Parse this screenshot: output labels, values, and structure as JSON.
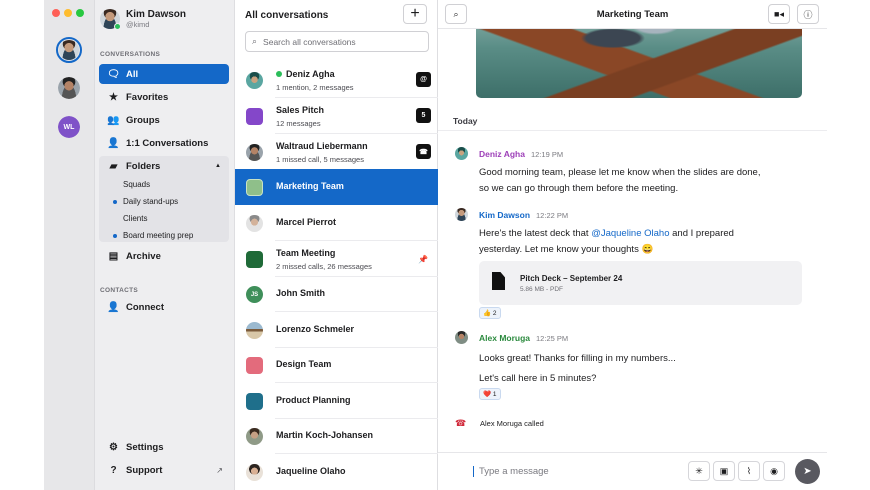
{
  "user": {
    "name": "Kim Dawson",
    "handle": "@kimd"
  },
  "rail": {
    "wl_initials": "WL"
  },
  "sidebar": {
    "conversations_header": "CONVERSATIONS",
    "items": [
      {
        "label": "All",
        "icon": "chat-bubble-icon"
      },
      {
        "label": "Favorites",
        "icon": "star-icon"
      },
      {
        "label": "Groups",
        "icon": "groups-icon"
      },
      {
        "label": "1:1 Conversations",
        "icon": "person-icon"
      },
      {
        "label": "Folders",
        "icon": "folder-icon"
      }
    ],
    "folders": [
      "Squads",
      "Daily stand-ups",
      "Clients",
      "Board meeting prep"
    ],
    "archive": "Archive",
    "contacts_header": "CONTACTS",
    "connect": "Connect",
    "settings": "Settings",
    "support": "Support"
  },
  "list": {
    "title": "All conversations",
    "search_placeholder": "Search all conversations",
    "rows": [
      {
        "title": "Deniz Agha",
        "sub": "1 mention, 2 messages",
        "badge": "@"
      },
      {
        "title": "Sales Pitch",
        "sub": "12 messages",
        "badge": "5"
      },
      {
        "title": "Waltraud Liebermann",
        "sub": "1 missed call, 5 messages",
        "badge": "☎"
      },
      {
        "title": "Marketing Team"
      },
      {
        "title": "Marcel Pierrot"
      },
      {
        "title": "Team Meeting",
        "sub": "2 missed calls, 26 messages"
      },
      {
        "title": "John Smith",
        "initials": "JS"
      },
      {
        "title": "Lorenzo Schmeler"
      },
      {
        "title": "Design Team"
      },
      {
        "title": "Product Planning"
      },
      {
        "title": "Martin Koch-Johansen"
      },
      {
        "title": "Jaqueline Olaho"
      }
    ],
    "colors": {
      "sales_pitch": "#8447c9",
      "marketing": "#8fbf8a",
      "team_meeting": "#1f6a38",
      "design": "#e36b7c",
      "product": "#1f6f8b"
    }
  },
  "chat": {
    "title": "Marketing Team",
    "day": "Today",
    "messages": [
      {
        "name": "Deniz Agha",
        "time": "12:19 PM",
        "color": "#9d3fb8",
        "lines": [
          "Good morning team, please let me know when the slides are done,",
          "so we can go through them before the meeting."
        ]
      },
      {
        "name": "Kim Dawson",
        "time": "12:22 PM",
        "color": "#1468c8",
        "line1_pre": "Here's the latest deck that ",
        "mention": "@Jaqueline Olaho",
        "line1_post": " and I prepared",
        "line2": "yesterday. Let me know your thoughts 😄"
      },
      {
        "name": "Alex Moruga",
        "time": "12:25 PM",
        "color": "#2b8a3e",
        "lines": [
          "Looks great! Thanks for filling in my numbers...",
          "Let's call here in 5 minutes?"
        ]
      }
    ],
    "file": {
      "name": "Pitch Deck – September 24",
      "meta": "5.86 MB - PDF"
    },
    "reactions": [
      "👍 2",
      "❤️ 1"
    ],
    "call_text": "Alex Moruga called",
    "composer_placeholder": "Type a message"
  }
}
